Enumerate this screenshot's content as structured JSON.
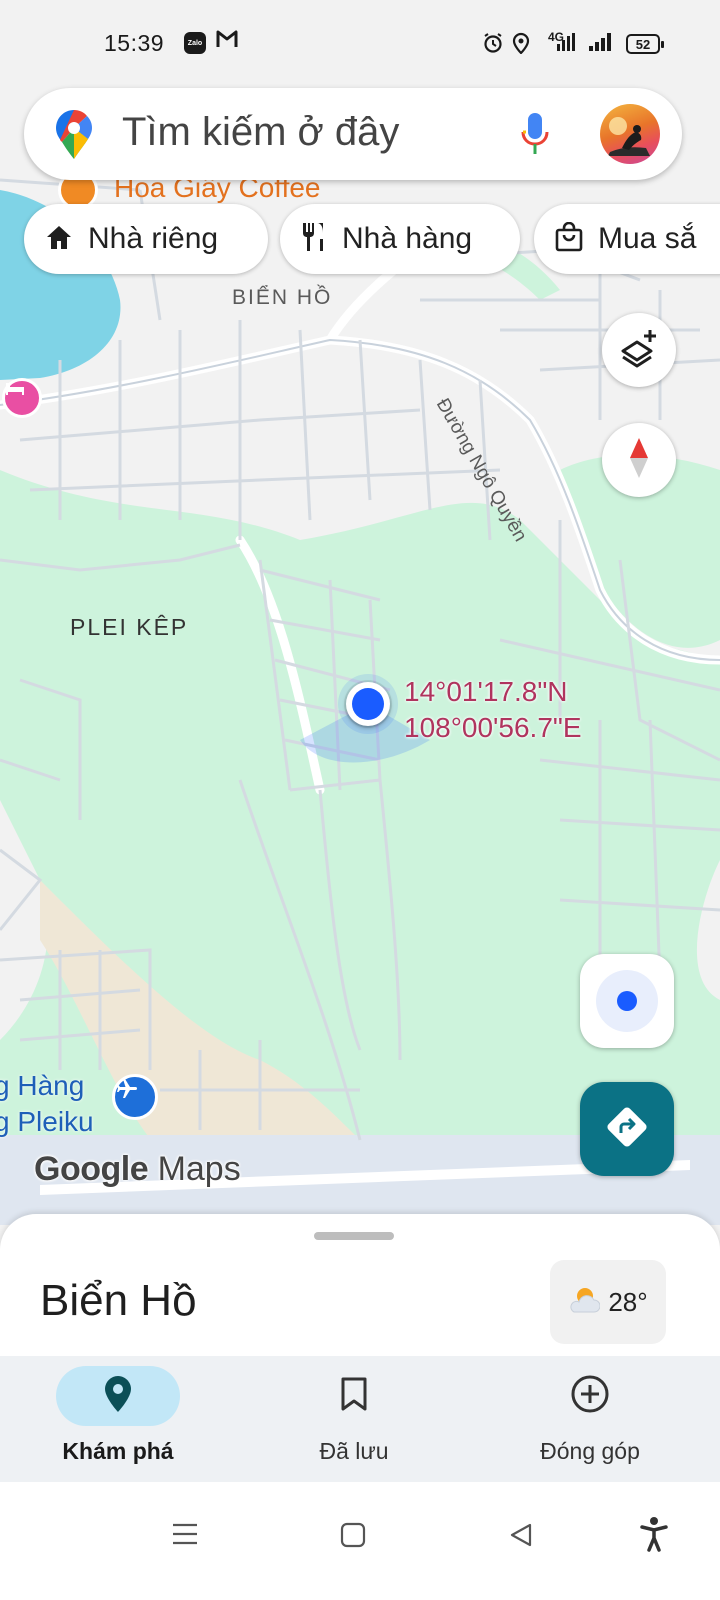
{
  "status_bar": {
    "time": "15:39",
    "zalo_icon_text": "Zalo",
    "network": "4G",
    "battery": "52"
  },
  "search": {
    "placeholder": "Tìm kiếm ở đây"
  },
  "chips": [
    {
      "label": "Nhà riêng",
      "icon": "home-icon"
    },
    {
      "label": "Nhà hàng",
      "icon": "restaurant-icon"
    },
    {
      "label": "Mua sắ",
      "icon": "shopping-bag-icon"
    }
  ],
  "map": {
    "poi_coffee": "Hoa Giấy Coffee",
    "area_bien_ho": "BIỂN HỒ",
    "area_plei_kep": "PLEI KÊP",
    "street_ngo_quyen": "Đường Ngô Quyền",
    "coordinates_lat": "14°01'17.8\"N",
    "coordinates_lng": "108°00'56.7\"E",
    "airport_line1": "g Hàng",
    "airport_line2": "g Pleiku",
    "logo_google": "Google",
    "logo_maps": "Maps",
    "colors": {
      "land": "#f2f2f2",
      "green": "#cdf3dc",
      "water": "#7fd3e6",
      "road": "#ffffff",
      "runway": "#dfe6f0",
      "sand": "#efe7d6",
      "accent": "#0b7285",
      "location_blue": "#1a5cff"
    }
  },
  "bottom_sheet": {
    "title": "Biển Hồ",
    "temperature": "28°"
  },
  "bottom_nav": {
    "explore": "Khám phá",
    "saved": "Đã lưu",
    "contribute": "Đóng góp"
  }
}
